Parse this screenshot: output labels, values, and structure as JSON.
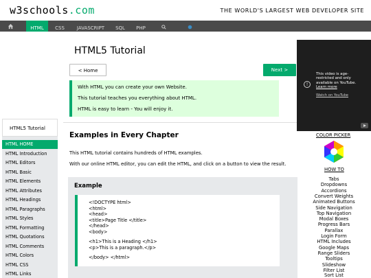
{
  "header": {
    "logo_main": "w3schools",
    "logo_dot": ".com",
    "tagline": "THE WORLD'S LARGEST WEB DEVELOPER SITE"
  },
  "nav": {
    "items": [
      "HTML",
      "CSS",
      "JAVASCRIPT",
      "SQL",
      "PHP"
    ]
  },
  "page_title": "HTML5 Tutorial",
  "buttons": {
    "home": "< Home",
    "next": "Next >"
  },
  "intro": [
    "With HTML you can create your own Website.",
    "This tutorial teaches you everything about HTML.",
    "HTML is easy to learn - You will enjoy it."
  ],
  "section": {
    "heading": "Examples in Every Chapter",
    "p1": "This HTML tutorial contains hundreds of HTML examples.",
    "p2": "With our online HTML editor, you can edit the HTML, and click on a button to view the result."
  },
  "example": {
    "title": "Example",
    "code": [
      "<!DOCTYPE html>",
      "<html>",
      "<head>",
      "<title>Page Title </title>",
      "</head>",
      "<body>",
      "",
      "<h1>This is a Heading </h1>",
      "<p>This is a paragraph.</p>",
      "",
      "</body> </html>"
    ]
  },
  "sidebar": {
    "title": "HTML5 Tutorial",
    "items": [
      "HTML HOME",
      "HTML Introduction",
      "HTML Editors",
      "HTML Basic",
      "HTML Elements",
      "HTML Attributes",
      "HTML Headings",
      "HTML Paragraphs",
      "HTML Styles",
      "HTML Formatting",
      "HTML Quotations",
      "HTML Comments",
      "HTML Colors",
      "HTML CSS",
      "HTML Links"
    ]
  },
  "video": {
    "line1": "This video is age-",
    "line2": "restricted and only",
    "line3": "available on YouTube.",
    "learn": "Learn more",
    "watch": "Watch on YouTube"
  },
  "right": {
    "color_picker": "COLOR PICKER",
    "how_to": "HOW TO",
    "links": [
      "Tabs",
      "Dropdowns",
      "Accordions",
      "Convert Weights",
      "Animated Buttons",
      "Side Navigation",
      "Top Navigation",
      "Modal Boxes",
      "Progress Bars",
      "Parallax",
      "Login Form",
      "HTML Includes",
      "Google Maps",
      "Range Sliders",
      "Tooltips",
      "Slideshow",
      "Filter List",
      "Sort List"
    ]
  },
  "colors": {
    "accent": "#04AA6D",
    "nav_bg": "#4a4a4a",
    "intro_bg": "#ddffdd",
    "panel_bg": "#e7e9eb"
  }
}
